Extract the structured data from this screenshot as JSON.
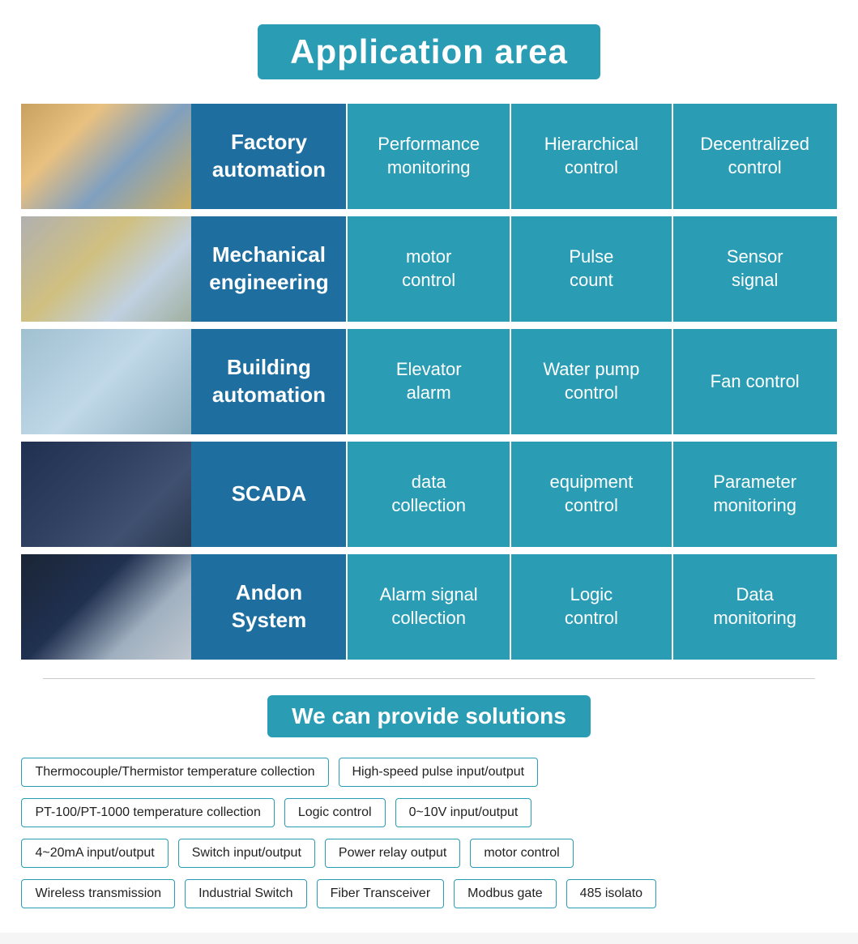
{
  "title": "Application area",
  "rows": [
    {
      "id": "factory",
      "category": "Factory\nautomation",
      "items": [
        "Performance\nmonitoring",
        "Hierarchical\ncontrol",
        "Decentralized\ncontrol"
      ]
    },
    {
      "id": "mechanical",
      "category": "Mechanical\nengineering",
      "items": [
        "motor\ncontrol",
        "Pulse\ncount",
        "Sensor\nsignal"
      ]
    },
    {
      "id": "building",
      "category": "Building\nautomation",
      "items": [
        "Elevator\nalarm",
        "Water pump\ncontrol",
        "Fan control"
      ]
    },
    {
      "id": "scada",
      "category": "SCADA",
      "items": [
        "data\ncollection",
        "equipment\ncontrol",
        "Parameter\nmonitoring"
      ]
    },
    {
      "id": "andon",
      "category": "Andon\nSystem",
      "items": [
        "Alarm signal\ncollection",
        "Logic\ncontrol",
        "Data\nmonitoring"
      ]
    }
  ],
  "solutions_title": "We can provide solutions",
  "tags_rows": [
    [
      "Thermocouple/Thermistor temperature collection",
      "High-speed pulse input/output"
    ],
    [
      "PT-100/PT-1000 temperature collection",
      "Logic control",
      "0~10V input/output"
    ],
    [
      "4~20mA input/output",
      "Switch input/output",
      "Power relay output",
      "motor control"
    ],
    [
      "Wireless transmission",
      "Industrial Switch",
      "Fiber Transceiver",
      "Modbus gate",
      "485 isolato"
    ]
  ]
}
